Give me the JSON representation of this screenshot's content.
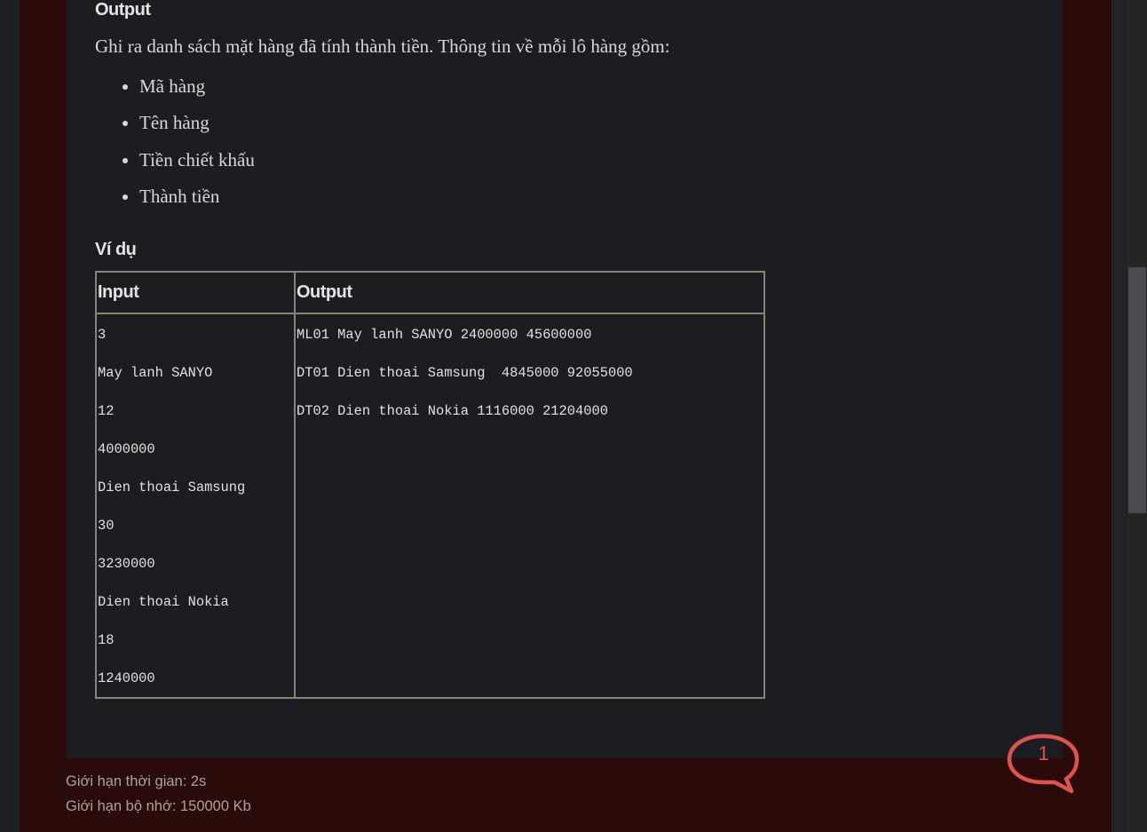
{
  "output_section": {
    "heading": "Output",
    "description": "Ghi ra danh sách mặt hàng đã tính thành tiền. Thông tin về mỗi lô hàng gồm:",
    "fields": [
      "Mã hàng",
      "Tên hàng",
      "Tiền chiết khấu",
      "Thành tiền"
    ]
  },
  "example_section": {
    "heading": "Ví dụ",
    "table": {
      "headers": {
        "input": "Input",
        "output": "Output"
      },
      "input_lines": [
        "3",
        "May lanh SANYO",
        "12",
        "4000000",
        "Dien thoai Samsung",
        "30",
        "3230000",
        "Dien thoai Nokia",
        "18",
        "1240000"
      ],
      "output_lines": [
        "ML01 May lanh SANYO 2400000 45600000",
        "DT01 Dien thoai Samsung  4845000 92055000",
        "DT02 Dien thoai Nokia 1116000 21204000"
      ]
    }
  },
  "limits": {
    "time_limit": "Giới hạn thời gian: 2s",
    "memory_limit": "Giới hạn bộ nhớ: 150000 Kb"
  },
  "chat": {
    "count": "1",
    "icon": "chat-bubble-icon",
    "color": "#e0524d"
  },
  "colors": {
    "frame": "#2b0a0a",
    "card": "#1b1d20",
    "table_border": "#8a8378"
  }
}
